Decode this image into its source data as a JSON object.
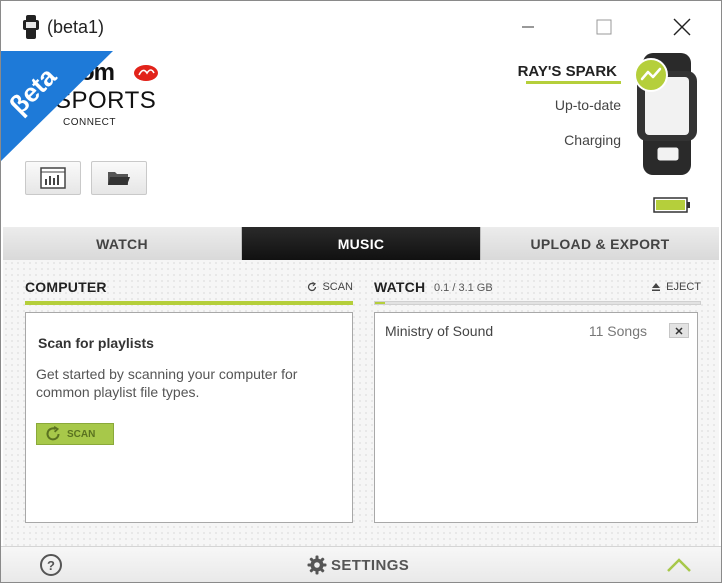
{
  "window": {
    "title": "(beta1)"
  },
  "header": {
    "beta_badge": "βeta",
    "logo_top": "tom",
    "logo_sports": "SPORTS",
    "logo_connect": "CONNECT",
    "tools": [
      {
        "icon": "stats-chart-icon"
      },
      {
        "icon": "folder-icon"
      }
    ]
  },
  "device": {
    "name": "RAY'S SPARK",
    "sync_status": "Up-to-date",
    "power_status": "Charging",
    "battery_level": 1.0,
    "accent_color": "#b5cf3b"
  },
  "tabs": [
    {
      "label": "WATCH",
      "active": false
    },
    {
      "label": "MUSIC",
      "active": true
    },
    {
      "label": "UPLOAD & EXPORT",
      "active": false
    }
  ],
  "computer_panel": {
    "title": "COMPUTER",
    "action_label": "SCAN",
    "heading": "Scan for playlists",
    "description": "Get started by scanning your computer for common playlist file types.",
    "button_label": "SCAN"
  },
  "watch_panel": {
    "title": "WATCH",
    "storage": "0.1 / 3.1 GB",
    "storage_fraction": 0.03,
    "action_label": "EJECT",
    "playlists": [
      {
        "name": "Ministry of Sound",
        "count": "11 Songs"
      }
    ]
  },
  "footer": {
    "help_label": "?",
    "settings_label": "SETTINGS"
  }
}
